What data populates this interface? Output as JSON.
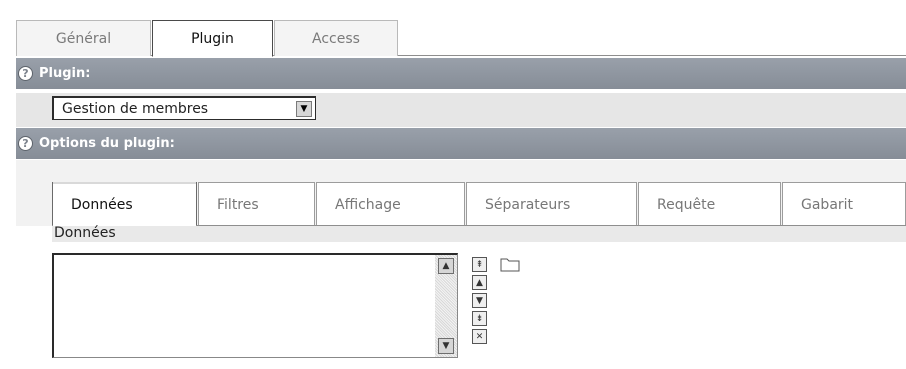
{
  "top_tabs": [
    {
      "label": "Général",
      "active": false
    },
    {
      "label": "Plugin",
      "active": true
    },
    {
      "label": "Access",
      "active": false
    }
  ],
  "plugin_section": {
    "help_icon": "?",
    "title": "Plugin:",
    "select_value": "Gestion de membres"
  },
  "options_section": {
    "help_icon": "?",
    "title": "Options du plugin:"
  },
  "inner_tabs": [
    {
      "label": "Données",
      "active": true
    },
    {
      "label": "Filtres",
      "active": false
    },
    {
      "label": "Affichage",
      "active": false
    },
    {
      "label": "Séparateurs",
      "active": false
    },
    {
      "label": "Requête",
      "active": false
    },
    {
      "label": "Gabarit",
      "active": false
    }
  ],
  "data_field": {
    "label": "Données",
    "value": ""
  },
  "colors": {
    "section_header": "#8f96a0",
    "accent_tab_underline": "#2c2c2c"
  }
}
